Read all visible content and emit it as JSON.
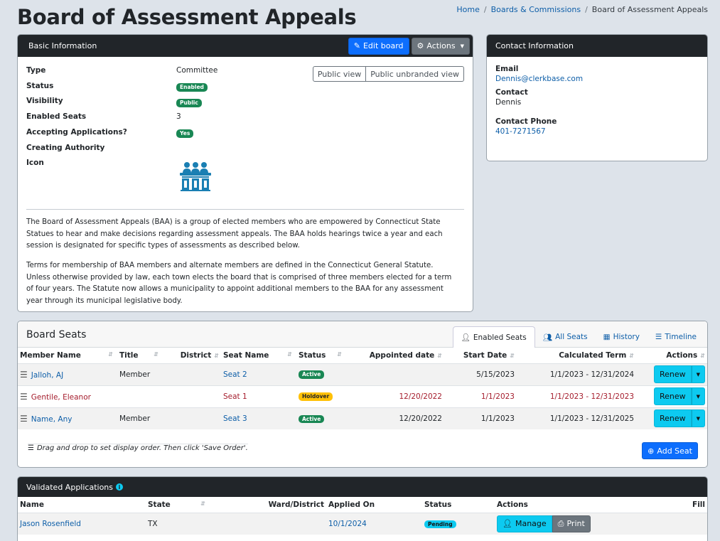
{
  "page": {
    "title": "Board of Assessment Appeals"
  },
  "breadcrumb": [
    "Home",
    "Boards & Commissions",
    "Board of Assessment Appeals"
  ],
  "basic": {
    "header": "Basic Information",
    "edit_label": "Edit board",
    "actions_label": "Actions",
    "public_view": "Public view",
    "public_unbranded_view": "Public unbranded view",
    "rows": [
      {
        "label": "Type",
        "value": "Committee"
      },
      {
        "label": "Status",
        "badge": "Enabled"
      },
      {
        "label": "Visibility",
        "badge": "Public"
      },
      {
        "label": "Enabled Seats",
        "value": "3"
      },
      {
        "label": "Accepting Applications?",
        "badge": "Yes"
      },
      {
        "label": "Creating Authority",
        "value": ""
      },
      {
        "label": "Icon",
        "value": ""
      }
    ],
    "icon_name": "board-podium-icon",
    "description": [
      "The Board of Assessment Appeals (BAA) is a group of elected members who are empowered by Connecticut State Statues to hear and make decisions regarding assessment appeals. The BAA holds hearings twice a year and each session is designated for specific types of assessments as described below.",
      "Terms for membership of BAA members and alternate members are defined in the Connecticut General Statute. Unless otherwise provided by law, each town elects the board that is comprised of three members elected for a term of four years. The Statute now allows a municipality to appoint additional members to the BAA for any assessment year through its municipal legislative body."
    ]
  },
  "contact": {
    "header": "Contact Information",
    "email_label": "Email",
    "email": "Dennis@clerkbase.com",
    "contact_label": "Contact",
    "contact": "Dennis",
    "phone_label": "Contact Phone",
    "phone": "401-7271567"
  },
  "seats": {
    "header": "Board Seats",
    "tabs": [
      "Enabled Seats",
      "All Seats",
      "History",
      "Timeline"
    ],
    "columns": [
      "Member Name",
      "Title",
      "District",
      "Seat Name",
      "Status",
      "Appointed date",
      "Start Date",
      "Calculated Term",
      "Actions"
    ],
    "rows": [
      {
        "member": "Jalloh, AJ",
        "title": "Member",
        "district": "",
        "seat": "Seat 2",
        "status": "Active",
        "appointed": "",
        "start": "5/15/2023",
        "term": "1/1/2023 - 12/31/2024",
        "action": "Renew"
      },
      {
        "member": "Gentile, Eleanor",
        "title": "",
        "district": "",
        "seat": "Seat 1",
        "status": "Holdover",
        "appointed": "12/20/2022",
        "start": "1/1/2023",
        "term": "1/1/2023 - 12/31/2023",
        "action": "Renew"
      },
      {
        "member": "Name, Any",
        "title": "Member",
        "district": "",
        "seat": "Seat 3",
        "status": "Active",
        "appointed": "12/20/2022",
        "start": "1/1/2023",
        "term": "1/1/2023 - 12/31/2025",
        "action": "Renew"
      }
    ],
    "drag_note": "Drag and drop to set display order. Then click 'Save Order'.",
    "add_seat": "Add Seat"
  },
  "applications": {
    "header": "Validated Applications",
    "columns": [
      "Name",
      "State",
      "Ward/District",
      "Applied On",
      "Status",
      "Actions",
      "Fill"
    ],
    "rows": [
      {
        "name": "Jason Rosenfield",
        "state": "TX",
        "ward": "",
        "applied": "10/1/2024",
        "status": "Pending",
        "manage": "Manage",
        "print": "Print"
      }
    ]
  },
  "colors": {
    "primary": "#0d6efd",
    "success": "#198754",
    "warning": "#ffc107",
    "info": "#0dcaf0",
    "dark": "#212529",
    "danger_text": "#a51d2d"
  }
}
